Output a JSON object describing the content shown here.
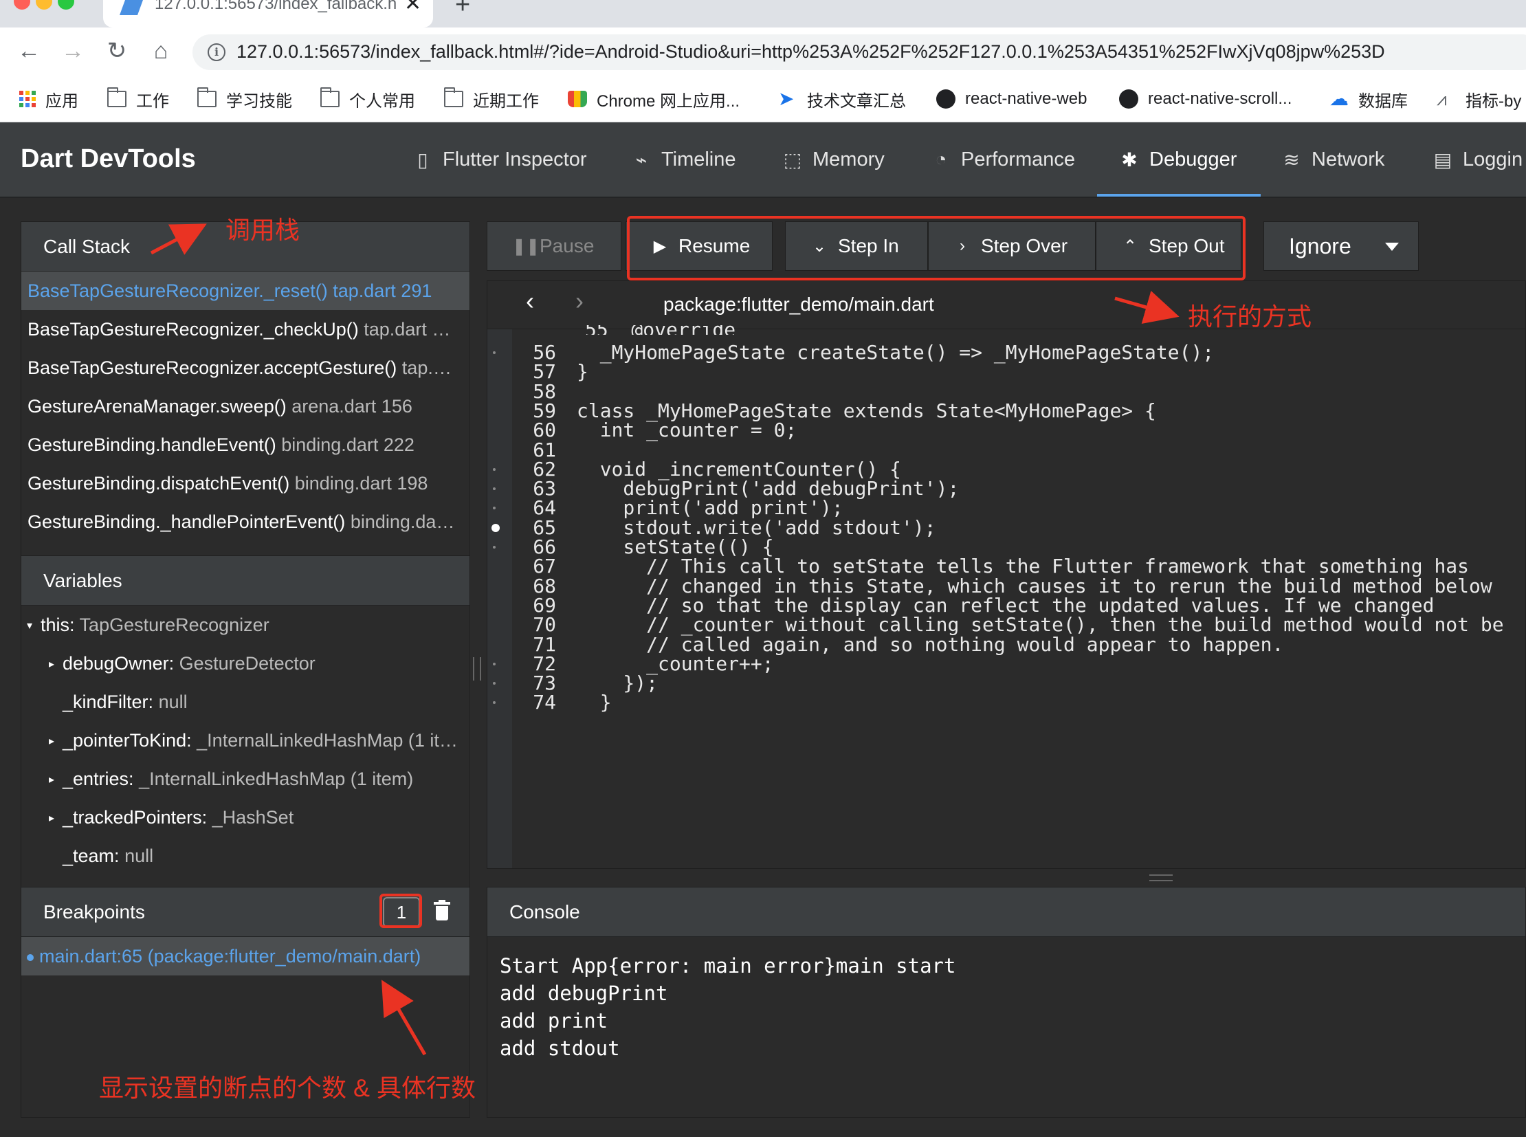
{
  "browser": {
    "tab_title": "127.0.0.1:56573/index_fallback.h",
    "url": "127.0.0.1:56573/index_fallback.html#/?ide=Android-Studio&uri=http%253A%252F%252F127.0.0.1%253A54351%252FIwXjVq08jpw%253D",
    "bookmarks": [
      {
        "label": "应用",
        "icon": "apps-grid-icon"
      },
      {
        "label": "工作",
        "icon": "folder-icon"
      },
      {
        "label": "学习技能",
        "icon": "folder-icon"
      },
      {
        "label": "个人常用",
        "icon": "folder-icon"
      },
      {
        "label": "近期工作",
        "icon": "folder-icon"
      },
      {
        "label": "Chrome 网上应用...",
        "icon": "chrome-webstore-icon"
      },
      {
        "label": "技术文章汇总",
        "icon": "paper-plane-icon"
      },
      {
        "label": "react-native-web",
        "icon": "github-icon"
      },
      {
        "label": "react-native-scroll...",
        "icon": "github-icon"
      },
      {
        "label": "数据库",
        "icon": "cloud-icon"
      },
      {
        "label": "指标-by",
        "icon": "chart-icon"
      }
    ]
  },
  "devtools": {
    "title": "Dart DevTools",
    "tabs": [
      {
        "label": "Flutter Inspector",
        "icon": "phone-icon",
        "glyph": "▯"
      },
      {
        "label": "Timeline",
        "icon": "pulse-icon",
        "glyph": "⌁"
      },
      {
        "label": "Memory",
        "icon": "box-icon",
        "glyph": "⬚"
      },
      {
        "label": "Performance",
        "icon": "gauge-icon",
        "glyph": "◔"
      },
      {
        "label": "Debugger",
        "icon": "bug-icon",
        "glyph": "✱"
      },
      {
        "label": "Network",
        "icon": "wifi-icon",
        "glyph": "≋"
      },
      {
        "label": "Loggin",
        "icon": "log-icon",
        "glyph": "▤"
      }
    ],
    "active_tab": "Debugger"
  },
  "call_stack": {
    "title": "Call Stack",
    "frames": [
      {
        "fn": "BaseTapGestureRecognizer._reset()",
        "loc": "tap.dart 291",
        "selected": true
      },
      {
        "fn": "BaseTapGestureRecognizer._checkUp()",
        "loc": "tap.dart …"
      },
      {
        "fn": "BaseTapGestureRecognizer.acceptGesture()",
        "loc": "tap.…"
      },
      {
        "fn": "GestureArenaManager.sweep()",
        "loc": "arena.dart 156"
      },
      {
        "fn": "GestureBinding.handleEvent()",
        "loc": "binding.dart 222"
      },
      {
        "fn": "GestureBinding.dispatchEvent()",
        "loc": "binding.dart 198"
      },
      {
        "fn": "GestureBinding._handlePointerEvent()",
        "loc": "binding.da…"
      }
    ]
  },
  "variables": {
    "title": "Variables",
    "rows": [
      {
        "name": "this:",
        "value": "TapGestureRecognizer",
        "caret": "▾",
        "indent": 0
      },
      {
        "name": "debugOwner:",
        "value": "GestureDetector",
        "caret": "▸",
        "indent": 1
      },
      {
        "name": "_kindFilter:",
        "value": "null",
        "caret": "",
        "indent": 1
      },
      {
        "name": "_pointerToKind:",
        "value": "_InternalLinkedHashMap (1 it…",
        "caret": "▸",
        "indent": 1
      },
      {
        "name": "_entries:",
        "value": "_InternalLinkedHashMap (1 item)",
        "caret": "▸",
        "indent": 1
      },
      {
        "name": "_trackedPointers:",
        "value": "_HashSet",
        "caret": "▸",
        "indent": 1
      },
      {
        "name": "_team:",
        "value": "null",
        "caret": "",
        "indent": 1
      }
    ]
  },
  "breakpoints": {
    "title": "Breakpoints",
    "count": "1",
    "items": [
      "main.dart:65 (package:flutter_demo/main.dart)"
    ]
  },
  "controls": {
    "pause": "Pause",
    "resume": "Resume",
    "step_in": "Step In",
    "step_over": "Step Over",
    "step_out": "Step Out",
    "ignore": "Ignore"
  },
  "editor": {
    "file": "package:flutter_demo/main.dart",
    "lines": [
      {
        "n": "56",
        "code": "  _MyHomePageState createState() => _MyHomePageState();",
        "dot": true
      },
      {
        "n": "57",
        "code": "}",
        "dot": false
      },
      {
        "n": "58",
        "code": "",
        "dot": false
      },
      {
        "n": "59",
        "code": "class _MyHomePageState extends State<MyHomePage> {",
        "dot": false
      },
      {
        "n": "60",
        "code": "  int _counter = 0;",
        "dot": false
      },
      {
        "n": "61",
        "code": "",
        "dot": false
      },
      {
        "n": "62",
        "code": "  void _incrementCounter() {",
        "dot": true
      },
      {
        "n": "63",
        "code": "    debugPrint('add debugPrint');",
        "dot": true
      },
      {
        "n": "64",
        "code": "    print('add print');",
        "dot": true
      },
      {
        "n": "65",
        "code": "    stdout.write('add stdout');",
        "breakpoint": true
      },
      {
        "n": "66",
        "code": "    setState(() {",
        "dot": true
      },
      {
        "n": "67",
        "code": "      // This call to setState tells the Flutter framework that something has",
        "dot": false
      },
      {
        "n": "68",
        "code": "      // changed in this State, which causes it to rerun the build method below",
        "dot": false
      },
      {
        "n": "69",
        "code": "      // so that the display can reflect the updated values. If we changed",
        "dot": false
      },
      {
        "n": "70",
        "code": "      // _counter without calling setState(), then the build method would not be",
        "dot": false
      },
      {
        "n": "71",
        "code": "      // called again, and so nothing would appear to happen.",
        "dot": false
      },
      {
        "n": "72",
        "code": "      _counter++;",
        "dot": true
      },
      {
        "n": "73",
        "code": "    });",
        "dot": true
      },
      {
        "n": "74",
        "code": "  }",
        "dot": true
      }
    ]
  },
  "console": {
    "title": "Console",
    "lines": [
      "Start App{error: main error}main start",
      "add debugPrint",
      "add print",
      "add stdout"
    ]
  },
  "annotations": {
    "call_stack_note": "调用栈",
    "exec_note": "执行的方式",
    "breakpoint_note": "显示设置的断点的个数 & 具体行数"
  },
  "colors": {
    "accent": "#5ba4ec",
    "annotation_red": "#ea3323",
    "panel_bg": "#2b2b2b",
    "header_bg": "#3c3f41"
  }
}
